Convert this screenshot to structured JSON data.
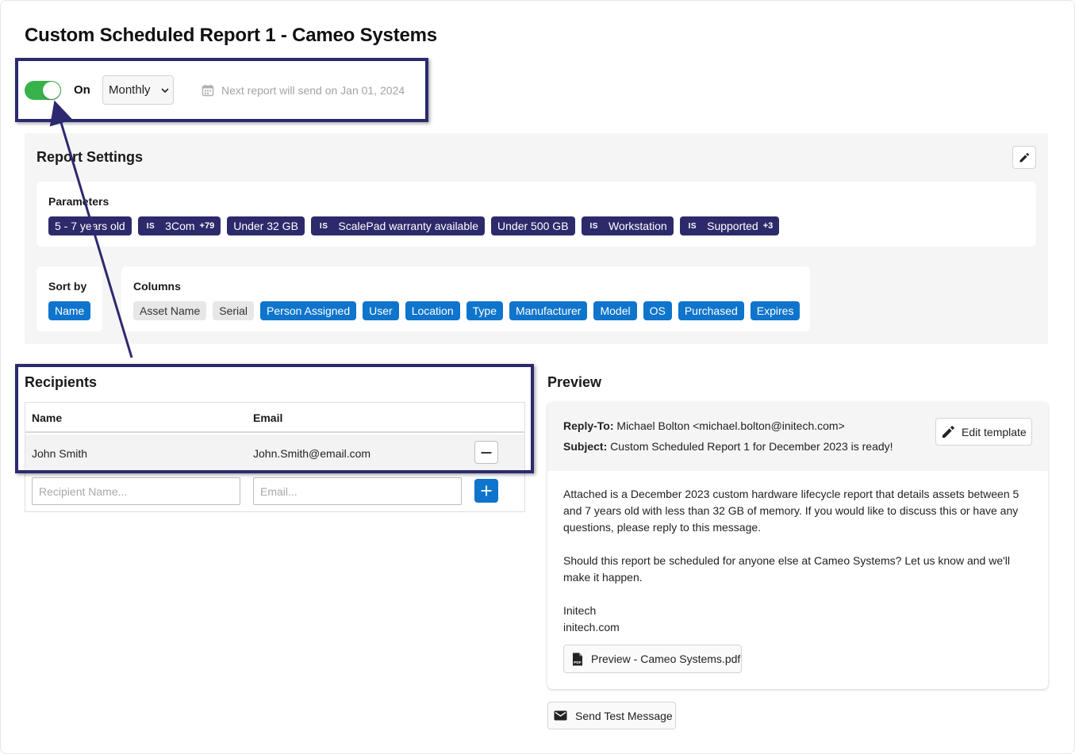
{
  "page": {
    "title": "Custom Scheduled Report 1 - Cameo Systems"
  },
  "schedule": {
    "toggle_label": "On",
    "toggle_on": true,
    "frequency": "Monthly",
    "next_send": "Next report will send on Jan 01, 2024"
  },
  "report_settings": {
    "title": "Report Settings",
    "parameters_label": "Parameters",
    "parameters": [
      {
        "text": "5 - 7 years old",
        "prefix": "",
        "more": ""
      },
      {
        "text": "3Com",
        "prefix": "IS",
        "more": "+79"
      },
      {
        "text": "Under 32 GB",
        "prefix": "",
        "more": ""
      },
      {
        "text": "ScalePad warranty available",
        "prefix": "IS",
        "more": ""
      },
      {
        "text": "Under 500 GB",
        "prefix": "",
        "more": ""
      },
      {
        "text": "Workstation",
        "prefix": "IS",
        "more": ""
      },
      {
        "text": "Supported",
        "prefix": "IS",
        "more": "+3"
      }
    ],
    "sort_label": "Sort by",
    "sort_value": "Name",
    "columns_label": "Columns",
    "columns": [
      {
        "text": "Asset Name",
        "active": false
      },
      {
        "text": "Serial",
        "active": false
      },
      {
        "text": "Person Assigned",
        "active": true
      },
      {
        "text": "User",
        "active": true
      },
      {
        "text": "Location",
        "active": true
      },
      {
        "text": "Type",
        "active": true
      },
      {
        "text": "Manufacturer",
        "active": true
      },
      {
        "text": "Model",
        "active": true
      },
      {
        "text": "OS",
        "active": true
      },
      {
        "text": "Purchased",
        "active": true
      },
      {
        "text": "Expires",
        "active": true
      }
    ]
  },
  "recipients": {
    "title": "Recipients",
    "header_name": "Name",
    "header_email": "Email",
    "rows": [
      {
        "name": "John Smith",
        "email": "John.Smith@email.com"
      }
    ],
    "name_placeholder": "Recipient Name...",
    "email_placeholder": "Email..."
  },
  "preview": {
    "title": "Preview",
    "reply_to_label": "Reply-To:",
    "reply_to_value": "Michael Bolton <michael.bolton@initech.com>",
    "subject_label": "Subject:",
    "subject_value": "Custom Scheduled Report 1 for December 2023 is ready!",
    "edit_template_label": "Edit template",
    "body_p1": "Attached is a December 2023 custom hardware lifecycle report that details assets between 5 and 7 years old with less than 32 GB of memory. If you would like to discuss this or have any questions, please reply to this message.",
    "body_p2": "Should this report be scheduled for anyone else at Cameo Systems? Let us know and we'll make it happen.",
    "sig_name": "Initech",
    "sig_site": "initech.com",
    "attachment": "Preview - Cameo Systems.pdf"
  },
  "send_test_label": "Send Test Message",
  "colors": {
    "toggle_green": "#38b24a",
    "chip_dark": "#2d2a6b",
    "chip_blue": "#0f74cc",
    "highlight_border": "#2b2a6e"
  },
  "icons": {
    "calendar": "calendar-icon",
    "edit": "pencil-icon",
    "remove": "minus-icon",
    "add": "plus-icon",
    "pdf": "pdf-file-icon",
    "mail": "envelope-icon",
    "dropdown": "chevron-down-icon"
  }
}
